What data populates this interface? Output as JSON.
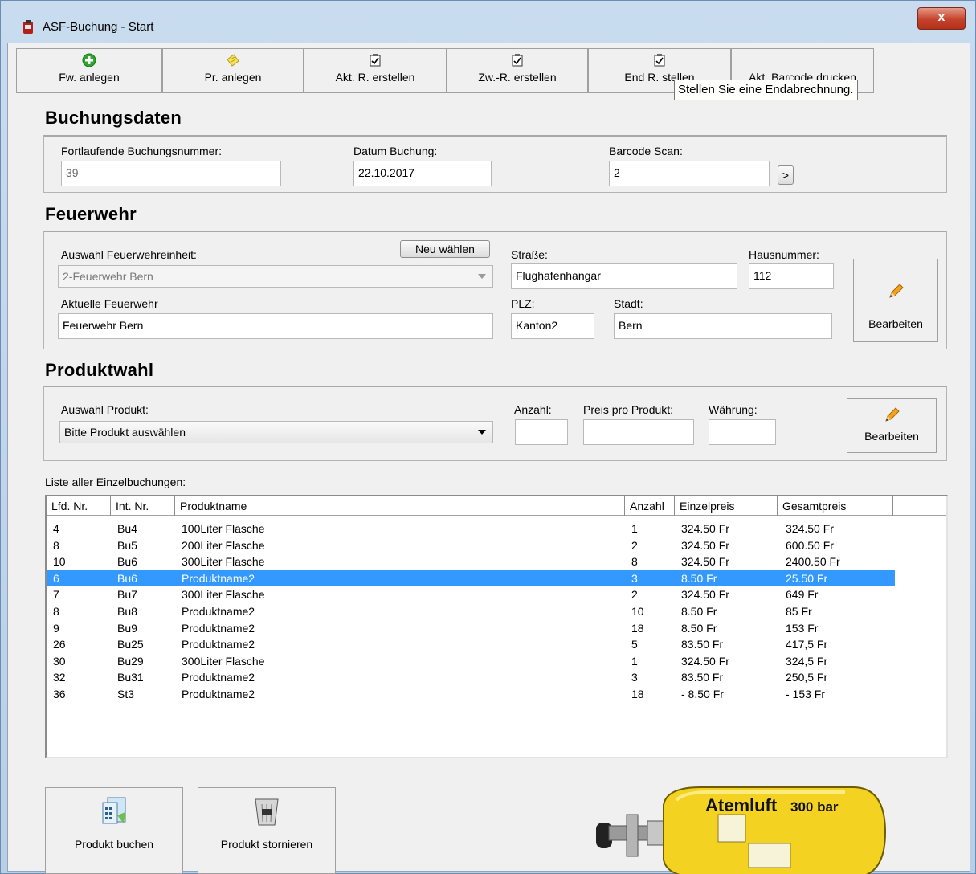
{
  "window": {
    "title": "ASF-Buchung - Start",
    "close_glyph": "x"
  },
  "toolbar": {
    "buttons": [
      {
        "label": "Fw. anlegen",
        "icon": "add-circle-icon"
      },
      {
        "label": "Pr. anlegen",
        "icon": "note-icon"
      },
      {
        "label": "Akt. R. erstellen",
        "icon": "checklist-icon"
      },
      {
        "label": "Zw.-R. erstellen",
        "icon": "checklist-icon"
      },
      {
        "label": "End R. stellen",
        "icon": "checklist-icon"
      },
      {
        "label": "Akt. Barcode drucken",
        "icon": ""
      }
    ]
  },
  "tooltip": "Stellen Sie eine Endabrechnung.",
  "buchungsdaten": {
    "heading": "Buchungsdaten",
    "nummer_label": "Fortlaufende Buchungsnummer:",
    "nummer_value": "39",
    "datum_label": "Datum Buchung:",
    "datum_value": "22.10.2017",
    "barcode_label": "Barcode Scan:",
    "barcode_value": "2",
    "barcode_go": ">"
  },
  "feuerwehr": {
    "heading": "Feuerwehr",
    "auswahl_label": "Auswahl Feuerwehreinheit:",
    "auswahl_value": "2-Feuerwehr Bern",
    "neu_label": "Neu wählen",
    "aktuelle_label": "Aktuelle Feuerwehr",
    "aktuelle_value": "Feuerwehr Bern",
    "strasse_label": "Straße:",
    "strasse_value": "Flughafenhangar",
    "hausnummer_label": "Hausnummer:",
    "hausnummer_value": "112",
    "plz_label": "PLZ:",
    "plz_value": "Kanton2",
    "stadt_label": "Stadt:",
    "stadt_value": "Bern",
    "edit_label": "Bearbeiten"
  },
  "produktwahl": {
    "heading": "Produktwahl",
    "auswahl_label": "Auswahl Produkt:",
    "auswahl_value": "Bitte Produkt auswählen",
    "anzahl_label": "Anzahl:",
    "preis_label": "Preis pro Produkt:",
    "waehrung_label": "Währung:",
    "edit_label": "Bearbeiten"
  },
  "liste": {
    "label": "Liste aller Einzelbuchungen:",
    "columns": [
      "Lfd. Nr.",
      "Int. Nr.",
      "Produktname",
      "Anzahl",
      "Einzelpreis",
      "Gesamtpreis"
    ],
    "selected_index": 3,
    "rows": [
      [
        "4",
        "Bu4",
        "100Liter Flasche",
        "1",
        "324.50 Fr",
        "324.50 Fr"
      ],
      [
        "8",
        "Bu5",
        "200Liter Flasche",
        "2",
        "324.50 Fr",
        "600.50 Fr"
      ],
      [
        "10",
        "Bu6",
        "300Liter Flasche",
        "8",
        "324.50 Fr",
        "2400.50 Fr"
      ],
      [
        "6",
        "Bu6",
        "Produktname2",
        "3",
        "8.50 Fr",
        "25.50 Fr"
      ],
      [
        "7",
        "Bu7",
        "300Liter Flasche",
        "2",
        "324.50 Fr",
        "649 Fr"
      ],
      [
        "8",
        "Bu8",
        "Produktname2",
        "10",
        "8.50 Fr",
        "85 Fr"
      ],
      [
        "9",
        "Bu9",
        "Produktname2",
        "18",
        "8.50 Fr",
        "153 Fr"
      ],
      [
        "26",
        "Bu25",
        "Produktname2",
        "5",
        "83.50 Fr",
        "417,5 Fr"
      ],
      [
        "30",
        "Bu29",
        "300Liter Flasche",
        "1",
        "324.50 Fr",
        "324,5 Fr"
      ],
      [
        "32",
        "Bu31",
        "Produktname2",
        "3",
        "83.50 Fr",
        "250,5 Fr"
      ],
      [
        "36",
        "St3",
        "Produktname2",
        "18",
        "- 8.50 Fr",
        "- 153 Fr"
      ]
    ]
  },
  "bottom": {
    "buchen_label": "Produkt buchen",
    "stornieren_label": "Produkt stornieren",
    "cylinder_text": "Atemluft",
    "cylinder_bar": "300 bar"
  },
  "colors": {
    "selection": "#3399ff",
    "cylinder": "#f3d221"
  }
}
